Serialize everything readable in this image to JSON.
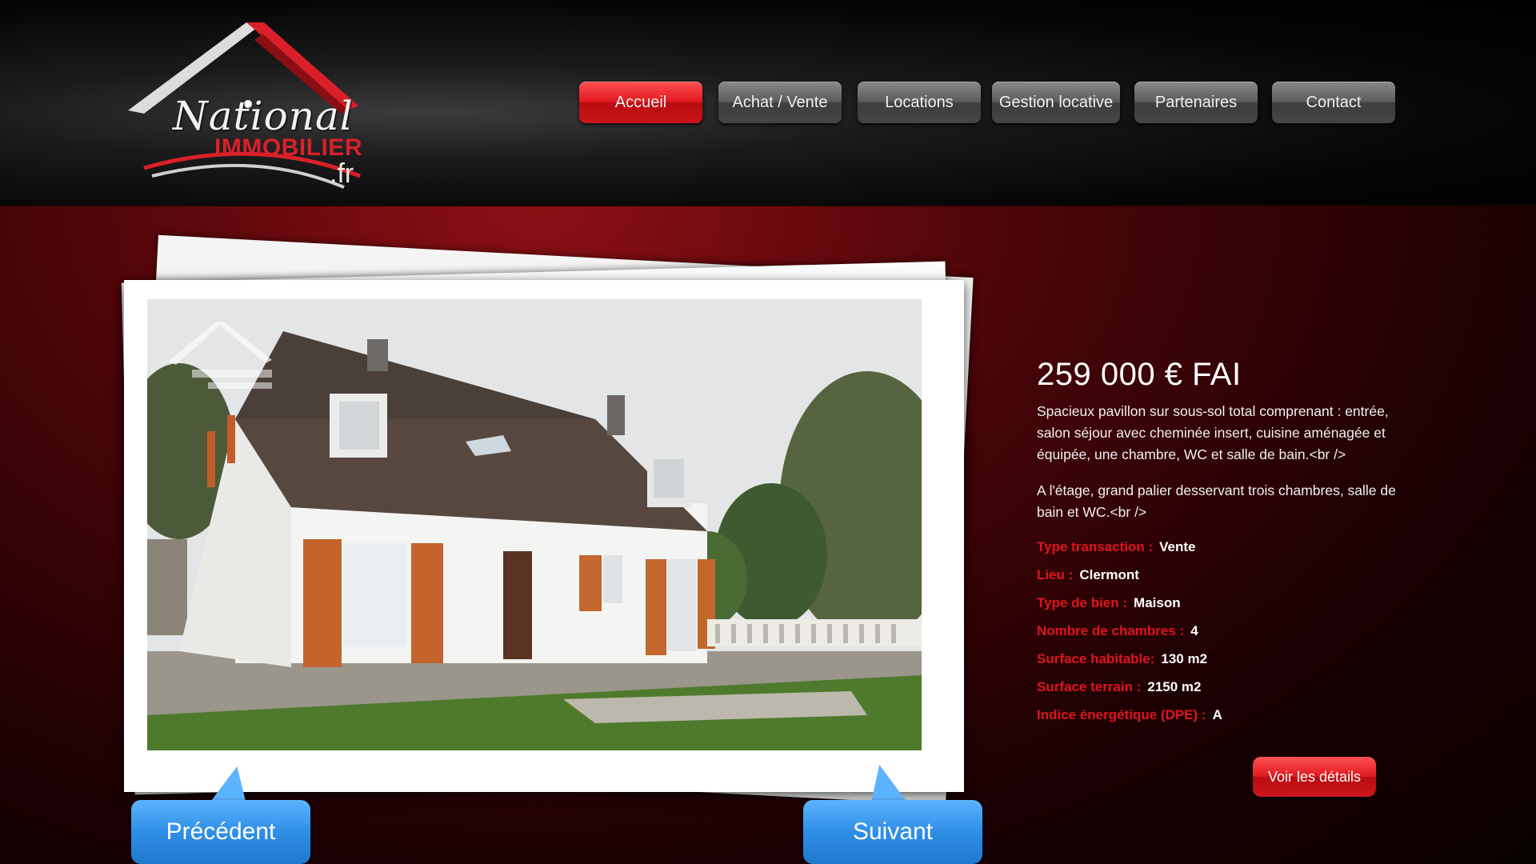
{
  "logo": {
    "line1": "National",
    "line2": "IMMOBILIER",
    "line3": ".fr"
  },
  "nav": {
    "items": [
      {
        "label": "Accueil",
        "active": true
      },
      {
        "label": "Achat / Vente",
        "active": false
      },
      {
        "label": "Locations",
        "active": false
      },
      {
        "label": "Gestion locative",
        "active": false
      },
      {
        "label": "Partenaires",
        "active": false
      },
      {
        "label": "Contact",
        "active": false
      }
    ]
  },
  "listing": {
    "price": "259 000 € FAI",
    "description_1": "Spacieux pavillon sur sous-sol total comprenant : entrée, salon séjour avec cheminée insert, cuisine aménagée et équipée, une chambre, WC et salle de bain.<br />",
    "description_2": "A l'étage, grand palier desservant trois chambres, salle de bain et WC.<br />",
    "attributes": [
      {
        "key": "Type transaction :",
        "value": "Vente"
      },
      {
        "key": "Lieu :",
        "value": "Clermont"
      },
      {
        "key": "Type de bien :",
        "value": "Maison"
      },
      {
        "key": "Nombre de chambres :",
        "value": "4"
      },
      {
        "key": "Surface habitable:",
        "value": "130 m2"
      },
      {
        "key": "Surface terrain :",
        "value": "2150 m2"
      },
      {
        "key": "Indice énergétique (DPE) :",
        "value": "A"
      }
    ],
    "details_button": "Voir les détails"
  },
  "slider": {
    "prev_label": "Précédent",
    "next_label": "Suivant"
  },
  "colors": {
    "accent_red": "#e01a1f",
    "bubble_blue": "#2f8fe6",
    "header_black": "#050505"
  }
}
